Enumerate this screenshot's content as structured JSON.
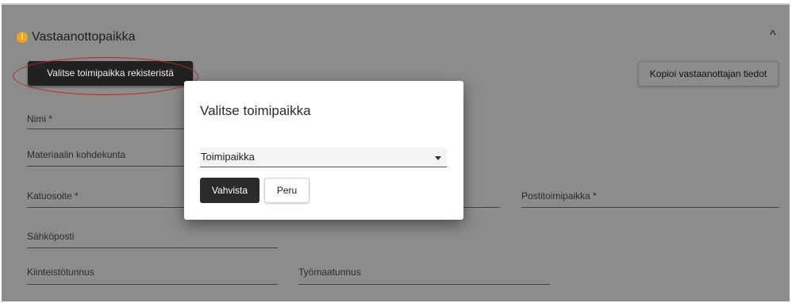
{
  "section": {
    "title": "Vastaanottopaikka",
    "warning_symbol": "!",
    "collapse_symbol": "^",
    "select_from_registry_label": "Valitse toimipaikka rekisteristä",
    "copy_recipient_label": "Kopioi vastaanottajan tiedot"
  },
  "fields": {
    "name": "Nimi *",
    "material_municipality": "Materiaalin kohdekunta",
    "street_address": "Katuosoite *",
    "post_office": "Postitoimipaikka *",
    "email": "Sähköposti",
    "property_id": "Kiinteistötunnus",
    "worksite_id": "Työmaatunnus"
  },
  "dialog": {
    "title": "Valitse toimipaikka",
    "select_value": "Toimipaikka",
    "confirm_label": "Vahvista",
    "cancel_label": "Peru"
  },
  "colors": {
    "overlay_background": "#8c8c8c",
    "warning": "#f2a516",
    "primary_button": "#212121",
    "annotation_ellipse": "#c41f1f"
  }
}
